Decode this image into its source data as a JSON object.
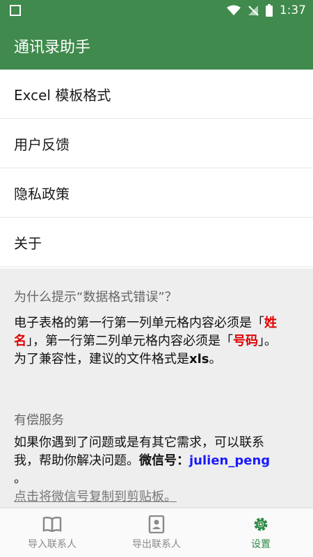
{
  "status": {
    "time": "1:37"
  },
  "app": {
    "title": "通讯录助手"
  },
  "menu": [
    {
      "label": "Excel 模板格式"
    },
    {
      "label": "用户反馈"
    },
    {
      "label": "隐私政策"
    },
    {
      "label": "关于"
    }
  ],
  "info": {
    "q_title": "为什么提示“数据格式错误”？",
    "q_body_1": "电子表格的第一行第一列单元格内容必须是「",
    "q_field_name": "姓名",
    "q_body_2": "」，第一行第二列单元格内容必须是「",
    "q_field_phone": "号码",
    "q_body_3": "」。为了兼容性，建议的文件格式是",
    "q_ext": "xls",
    "q_body_4": "。",
    "paid_title": "有偿服务",
    "paid_body": "如果你遇到了问题或是有其它需求，可以联系我，帮助你解决问题。",
    "wechat_label": "微信号：",
    "wechat_id": "julien_peng",
    "period": " 。",
    "copy_link": "点击将微信号复制到剪贴板。"
  },
  "nav": {
    "import_label": "导入联系人",
    "export_label": "导出联系人",
    "settings_label": "设置"
  },
  "colors": {
    "primary": "#3f8a4c",
    "accent": "#2f8a45",
    "highlight": "#e00000",
    "link": "#1a1aff"
  }
}
